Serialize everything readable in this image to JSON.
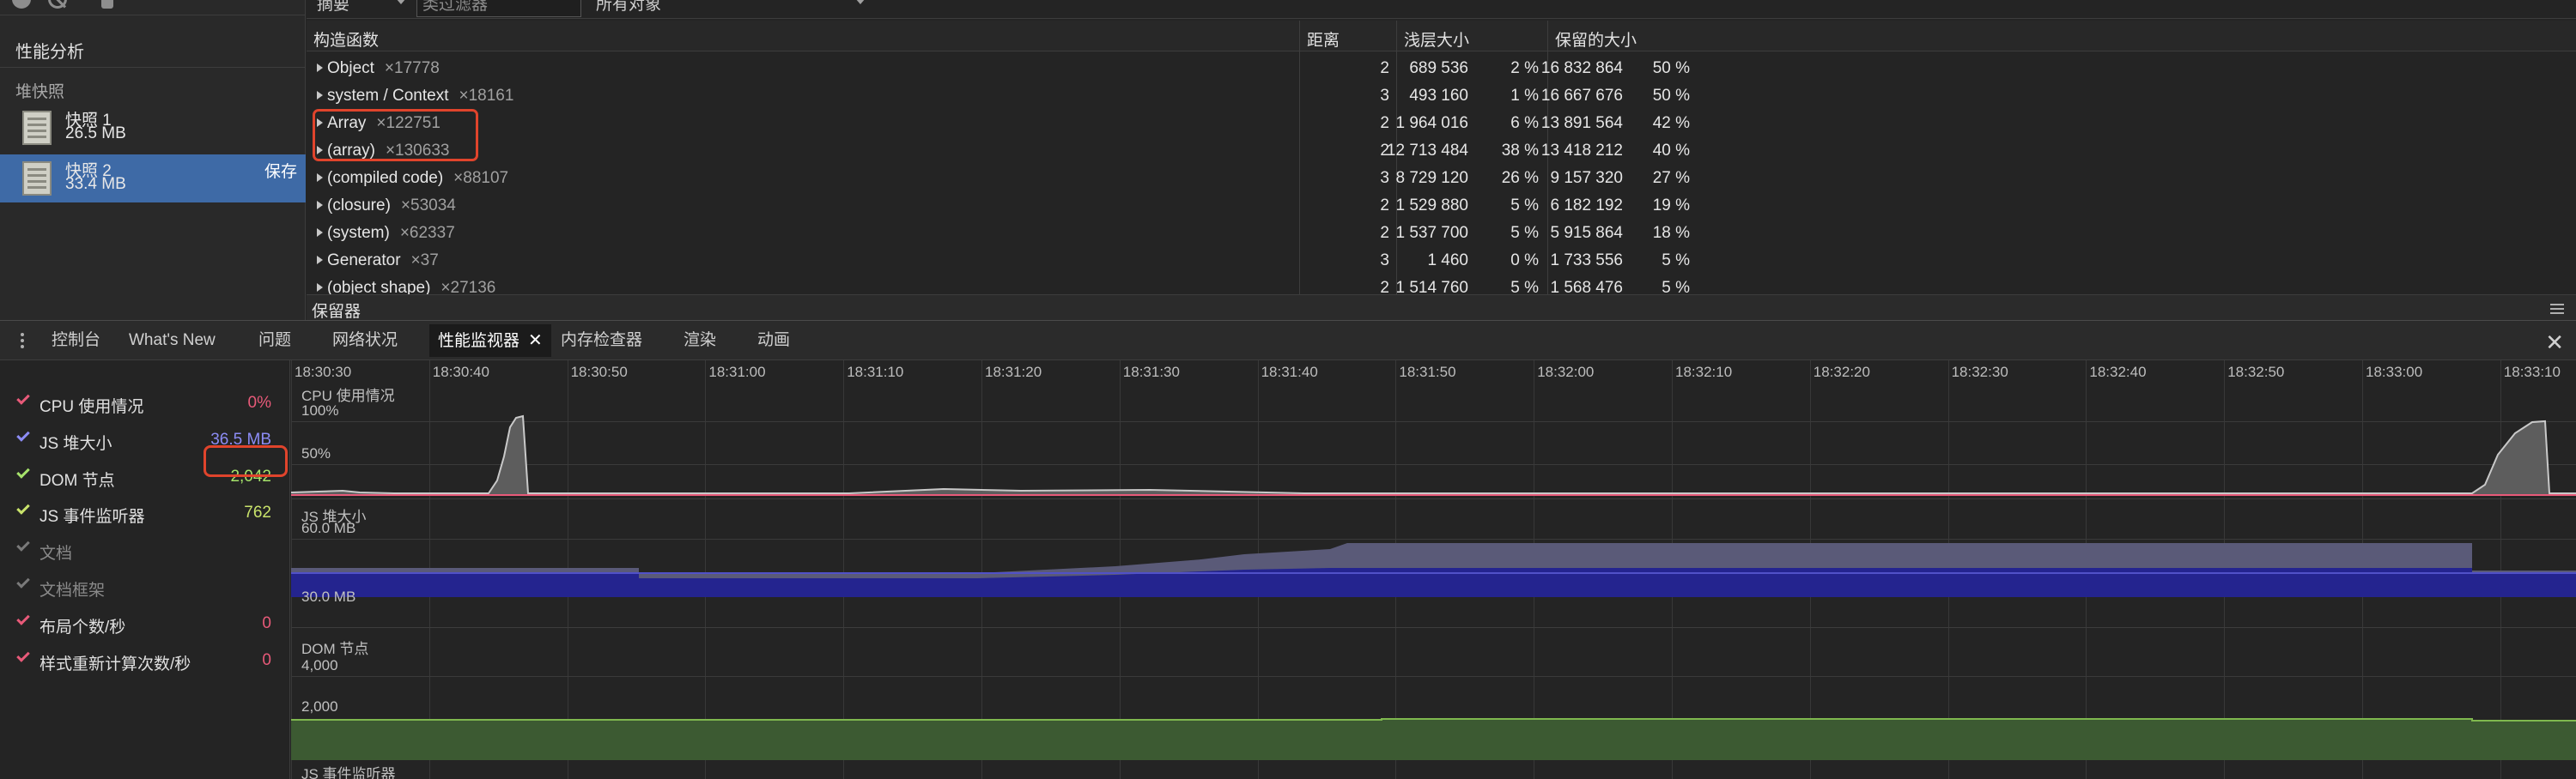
{
  "sidebar": {
    "title": "性能分析",
    "group_label": "堆快照",
    "snapshots": [
      {
        "name": "快照 1",
        "size": "26.5 MB",
        "selected": false
      },
      {
        "name": "快照 2",
        "size": "33.4 MB",
        "selected": true,
        "action": "保存"
      }
    ]
  },
  "filter_bar": {
    "view_select": "摘要",
    "class_filter_placeholder": "类过滤器",
    "objects_select": "所有对象"
  },
  "heap_table": {
    "columns": {
      "constructor": "构造函数",
      "distance": "距离",
      "shallow": "浅层大小",
      "retained": "保留的大小"
    },
    "rows": [
      {
        "name": "Object",
        "count": "×17778",
        "distance": "2",
        "shallow": "689 536",
        "shallow_pct": "2 %",
        "retained": "16 832 864",
        "retained_pct": "50 %"
      },
      {
        "name": "system / Context",
        "count": "×18161",
        "distance": "3",
        "shallow": "493 160",
        "shallow_pct": "1 %",
        "retained": "16 667 676",
        "retained_pct": "50 %"
      },
      {
        "name": "Array",
        "count": "×122751",
        "distance": "2",
        "shallow": "1 964 016",
        "shallow_pct": "6 %",
        "retained": "13 891 564",
        "retained_pct": "42 %"
      },
      {
        "name": "(array)",
        "count": "×130633",
        "distance": "2",
        "shallow": "12 713 484",
        "shallow_pct": "38 %",
        "retained": "13 418 212",
        "retained_pct": "40 %"
      },
      {
        "name": "(compiled code)",
        "count": "×88107",
        "distance": "3",
        "shallow": "8 729 120",
        "shallow_pct": "26 %",
        "retained": "9 157 320",
        "retained_pct": "27 %"
      },
      {
        "name": "(closure)",
        "count": "×53034",
        "distance": "2",
        "shallow": "1 529 880",
        "shallow_pct": "5 %",
        "retained": "6 182 192",
        "retained_pct": "19 %"
      },
      {
        "name": "(system)",
        "count": "×62337",
        "distance": "2",
        "shallow": "1 537 700",
        "shallow_pct": "5 %",
        "retained": "5 915 864",
        "retained_pct": "18 %"
      },
      {
        "name": "Generator",
        "count": "×37",
        "distance": "3",
        "shallow": "1 460",
        "shallow_pct": "0 %",
        "retained": "1 733 556",
        "retained_pct": "5 %"
      },
      {
        "name": "(object shape)",
        "count": "×27136",
        "distance": "2",
        "shallow": "1 514 760",
        "shallow_pct": "5 %",
        "retained": "1 568 476",
        "retained_pct": "5 %"
      }
    ]
  },
  "retainers_label": "保留器",
  "drawer_tabs": [
    "控制台",
    "What's New",
    "问题",
    "网络状况",
    "性能监视器",
    "内存检查器",
    "渲染",
    "动画"
  ],
  "drawer_active_tab": "性能监视器",
  "drawer_close": "✕",
  "tab_close": "✕",
  "metrics": [
    {
      "label": "CPU 使用情况",
      "value": "0%",
      "checked": true,
      "color": "#e85a79"
    },
    {
      "label": "JS 堆大小",
      "value": "36.5 MB",
      "checked": true,
      "color": "#8c8cf5"
    },
    {
      "label": "DOM 节点",
      "value": "2,042",
      "checked": true,
      "color": "#a6e36b"
    },
    {
      "label": "JS 事件监听器",
      "value": "762",
      "checked": true,
      "color": "#c9e36b"
    },
    {
      "label": "文档",
      "value": "",
      "checked": false,
      "color": "#7a7a7a"
    },
    {
      "label": "文档框架",
      "value": "",
      "checked": false,
      "color": "#7a7a7a"
    },
    {
      "label": "布局个数/秒",
      "value": "0",
      "checked": true,
      "color": "#e85a79"
    },
    {
      "label": "样式重新计算次数/秒",
      "value": "0",
      "checked": true,
      "color": "#e85a79"
    }
  ],
  "time_ticks": [
    "18:30:30",
    "18:30:40",
    "18:30:50",
    "18:31:00",
    "18:31:10",
    "18:31:20",
    "18:31:30",
    "18:31:40",
    "18:31:50",
    "18:32:00",
    "18:32:10",
    "18:32:20",
    "18:32:30",
    "18:32:40",
    "18:32:50",
    "18:33:00",
    "18:33:10"
  ],
  "charts": {
    "cpu": {
      "title": "CPU 使用情况",
      "ref_top": "100%",
      "ref_mid": "50%",
      "color": "#e85a79"
    },
    "heap": {
      "title": "JS 堆大小",
      "ref_top": "60.0 MB",
      "ref_mid": "30.0 MB",
      "color": "#8c8cf5"
    },
    "dom": {
      "title": "DOM 节点",
      "ref_top": "4,000",
      "ref_mid": "2,000",
      "color": "#a6e36b"
    },
    "listeners": {
      "title": "JS 事件监听器"
    }
  }
}
